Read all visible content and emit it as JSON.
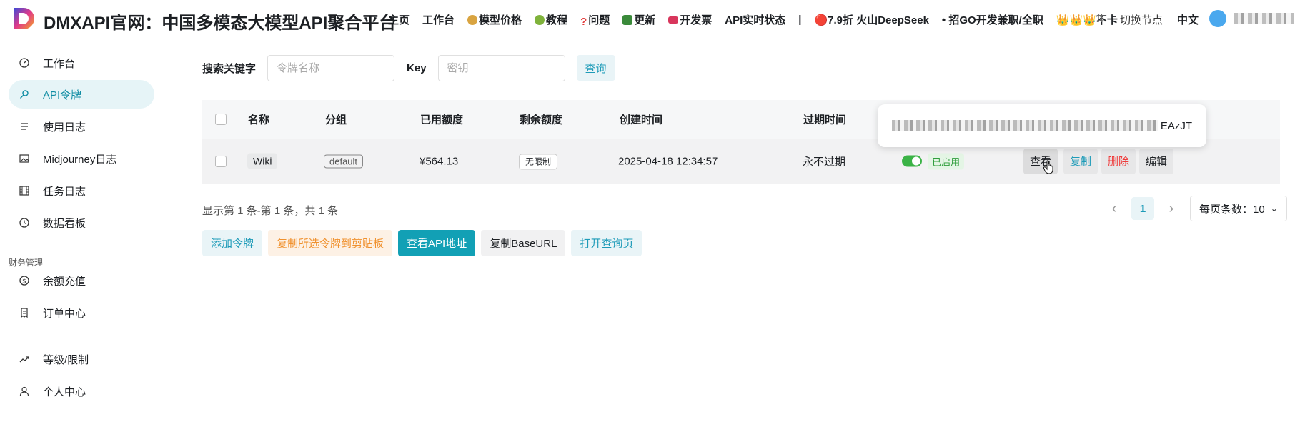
{
  "header": {
    "title": "DMXAPI官网：中国多模态大模型API聚合平台",
    "nav": [
      {
        "label": "主页",
        "emoji": ""
      },
      {
        "label": "工作台",
        "emoji": ""
      },
      {
        "label": "模型价格",
        "emoji": "#d9a441"
      },
      {
        "label": "教程",
        "emoji": "#7fb23b"
      },
      {
        "label": "问题",
        "emoji": "#e23b3b"
      },
      {
        "label": "更新",
        "emoji": "#3a8a3a"
      },
      {
        "label": "开发票",
        "emoji": "#d8365c"
      },
      {
        "label": "API实时状态",
        "emoji": ""
      }
    ],
    "separator": "|",
    "promo_1": "🔴7.9折 火山DeepSeek",
    "promo_2": "• 招GO开发兼职/全职",
    "promo_3": "👑👑👑不卡",
    "switch_node": "切换节点",
    "language": "中文"
  },
  "sidebar": {
    "items": [
      {
        "label": "工作台",
        "icon": "dashboard-icon"
      },
      {
        "label": "API令牌",
        "icon": "key-icon"
      },
      {
        "label": "使用日志",
        "icon": "log-icon"
      },
      {
        "label": "Midjourney日志",
        "icon": "image-icon"
      },
      {
        "label": "任务日志",
        "icon": "film-icon"
      },
      {
        "label": "数据看板",
        "icon": "clock-icon"
      }
    ],
    "finance_group": "财务管理",
    "finance_items": [
      {
        "label": "余额充值",
        "icon": "coin-icon"
      },
      {
        "label": "订单中心",
        "icon": "receipt-icon"
      }
    ],
    "account_items": [
      {
        "label": "等级/限制",
        "icon": "trend-icon"
      },
      {
        "label": "个人中心",
        "icon": "user-icon"
      }
    ]
  },
  "search": {
    "keyword_label": "搜索关键字",
    "keyword_placeholder": "令牌名称",
    "key_label": "Key",
    "key_placeholder": "密钥",
    "query_button": "查询"
  },
  "table": {
    "columns": [
      "名称",
      "分组",
      "已用额度",
      "剩余额度",
      "创建时间",
      "过期时间"
    ],
    "rows": [
      {
        "name": "Wiki",
        "group": "default",
        "used": "¥564.13",
        "remaining": "无限制",
        "created": "2025-04-18 12:34:57",
        "expires": "永不过期",
        "status": "已启用",
        "enabled": true
      }
    ],
    "actions": {
      "view": "查看",
      "copy": "复制",
      "delete": "删除",
      "edit": "编辑"
    }
  },
  "popup": {
    "key_suffix": "EAzJT"
  },
  "summary": "显示第 1 条-第 1 条，共 1 条",
  "pagination": {
    "current_page": "1",
    "page_size": "每页条数：10"
  },
  "buttons": {
    "add": "添加令牌",
    "copy_selected": "复制所选令牌到剪贴板",
    "view_api": "查看API地址",
    "copy_base": "复制BaseURL",
    "open_query": "打开查询页"
  },
  "colors": {
    "accent": "#1d9bb8",
    "primary_btn": "#12a0b5",
    "orange": "#f0912e",
    "danger": "#ef3a3a",
    "success": "#3bb346"
  }
}
